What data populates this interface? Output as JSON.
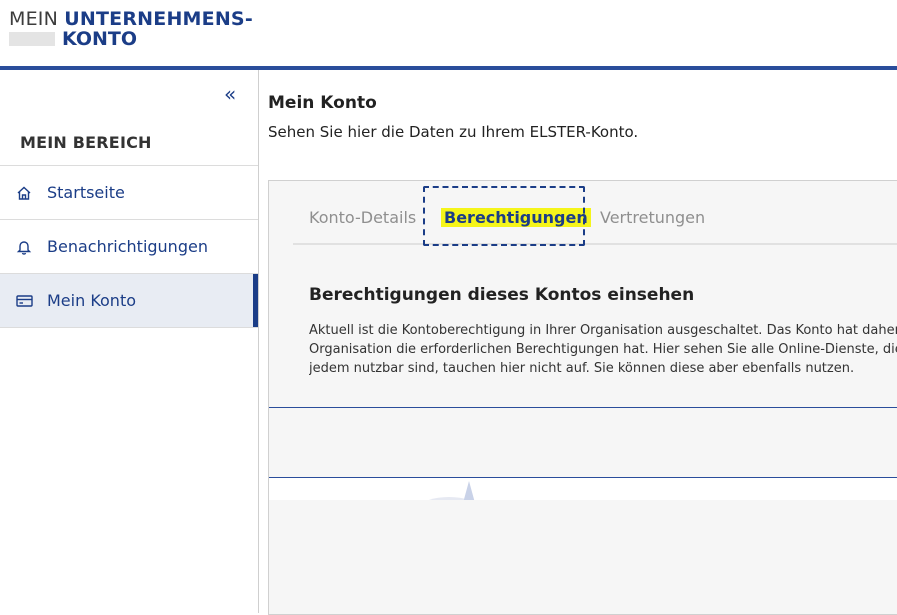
{
  "header": {
    "logo_line1_prefix": "MEIN",
    "logo_line1_bold": "UNTERNEHMENS-",
    "logo_line2": "KONTO"
  },
  "sidebar": {
    "collapse_label": "«",
    "title": "MEIN BEREICH",
    "items": [
      {
        "label": "Startseite",
        "icon": "home-icon"
      },
      {
        "label": "Benachrichtigungen",
        "icon": "bell-icon"
      },
      {
        "label": "Mein Konto",
        "icon": "card-icon",
        "active": true
      }
    ]
  },
  "main": {
    "title": "Mein Konto",
    "subtitle": "Sehen Sie hier die Daten zu Ihrem ELSTER-Konto.",
    "tabs": [
      {
        "label": "Konto-Details"
      },
      {
        "label": "Berechtigungen",
        "active": true
      },
      {
        "label": "Vertretungen"
      }
    ],
    "section_title": "Berechtigungen dieses Kontos einsehen",
    "section_lines": [
      "Aktuell ist die Kontoberechtigung in Ihrer Organisation ausgeschaltet. Das Konto hat daher",
      "Organisation die erforderlichen Berechtigungen hat. Hier sehen Sie alle Online-Dienste, die",
      "jedem nutzbar sind, tauchen hier nicht auf. Sie können diese aber ebenfalls nutzen."
    ]
  },
  "colors": {
    "brand_blue": "#1b3d87",
    "highlight": "#f5f51a",
    "nav_active_bg": "#e8ecf3"
  }
}
